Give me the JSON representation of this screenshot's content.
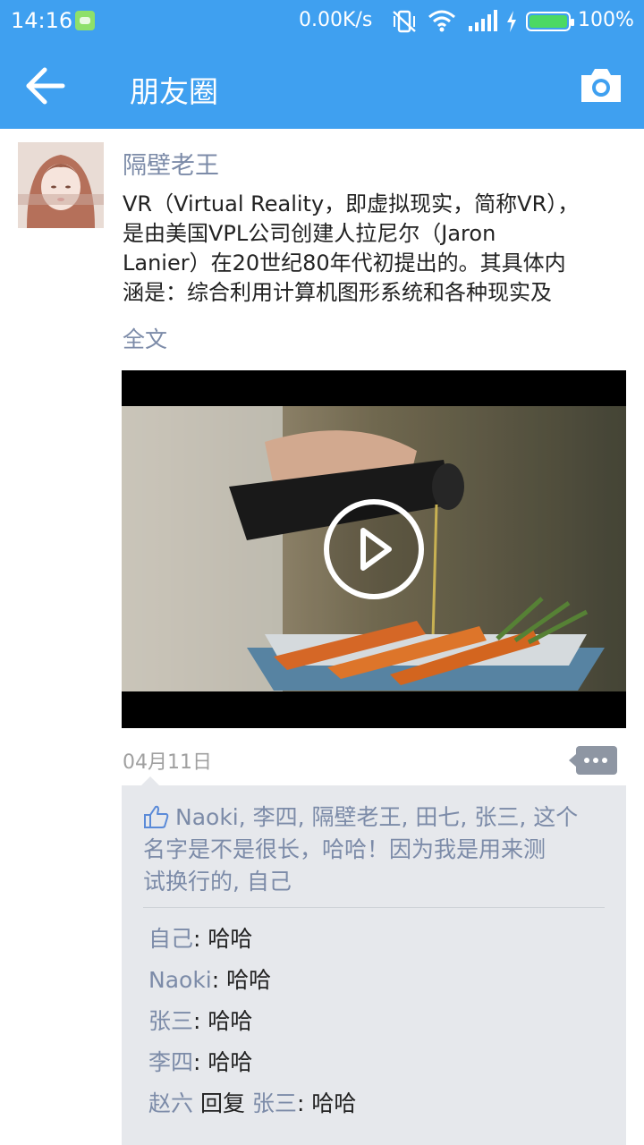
{
  "status_bar": {
    "time": "14:16",
    "network_speed": "0.00K/s",
    "battery_percent": "100%",
    "icons": [
      "app-notification-icon",
      "vibrate-off-icon",
      "wifi-icon",
      "signal-icon",
      "charging-icon",
      "battery-icon"
    ]
  },
  "toolbar": {
    "title": "朋友圈",
    "back_icon": "arrow-left-icon",
    "camera_icon": "camera-icon"
  },
  "post": {
    "author": "隔壁老王",
    "content_lines": [
      "VR（Virtual Reality，即虚拟现实，简称VR），",
      "是由美国VPL公司创建人拉尼尔（Jaron",
      "Lanier）在20世纪80年代初提出的。其具体内",
      "涵是：综合利用计算机图形系统和各种现实及"
    ],
    "full_text_link": "全文",
    "video": {
      "play_icon": "play-circle-icon"
    },
    "date": "04月11日",
    "more_icon": "more-dots-icon"
  },
  "likes": {
    "icon": "thumbs-up-icon",
    "lines": [
      "Naoki, 李四, 隔壁老王, 田七, 张三, 这个",
      "名字是不是很长，哈哈！因为我是用来测",
      "试换行的, 自己"
    ]
  },
  "comments": [
    {
      "name": "自己",
      "reply_word": "",
      "target": "",
      "separator": ": ",
      "text": "哈哈"
    },
    {
      "name": "Naoki",
      "reply_word": "",
      "target": "",
      "separator": ": ",
      "text": "哈哈"
    },
    {
      "name": "张三",
      "reply_word": "",
      "target": "",
      "separator": ": ",
      "text": "哈哈"
    },
    {
      "name": "李四",
      "reply_word": "",
      "target": "",
      "separator": ": ",
      "text": "哈哈"
    },
    {
      "name": "赵六",
      "reply_word": " 回复 ",
      "target": "张三",
      "separator": ": ",
      "text": "哈哈"
    }
  ],
  "colors": {
    "primary": "#3fa0f0",
    "link": "#7c8ba8",
    "panel_bg": "#e6e8ec",
    "battery_fill": "#4cd964"
  }
}
